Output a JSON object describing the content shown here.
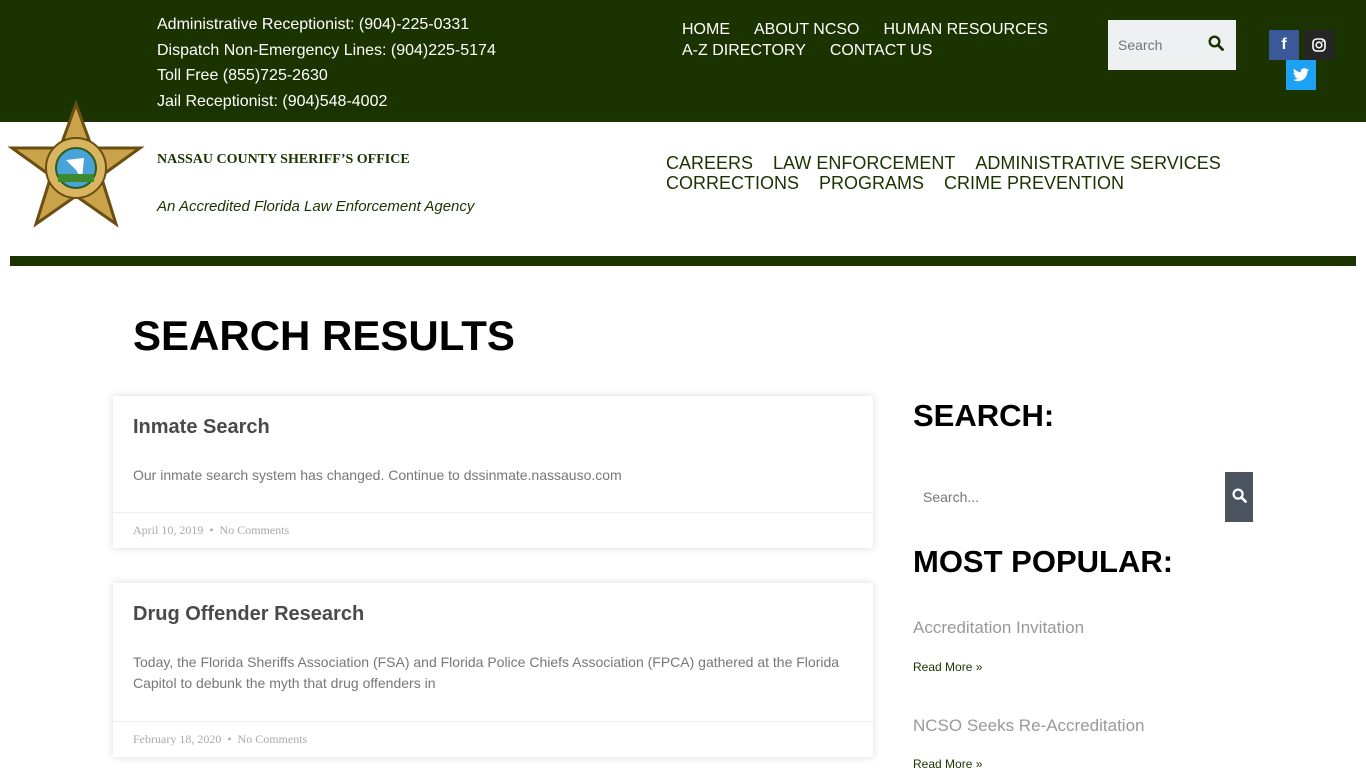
{
  "topbar": {
    "contacts": [
      "Administrative Receptionist: (904)-225-0331",
      "Dispatch Non-Emergency Lines: (904)225-5174",
      "Toll Free (855)725-2630",
      "Jail Receptionist: (904)548-4002"
    ],
    "nav": [
      "HOME",
      "ABOUT NCSO",
      "HUMAN RESOURCES",
      "A-Z DIRECTORY",
      "CONTACT US"
    ],
    "search_placeholder": "Search",
    "social": [
      {
        "icon": "facebook-icon",
        "color": "#3b5998"
      },
      {
        "icon": "instagram-icon",
        "color": "#262626"
      },
      {
        "icon": "twitter-icon",
        "color": "#1da1f2"
      }
    ]
  },
  "header": {
    "org_name": "NASSAU COUNTY SHERIFF’S OFFICE",
    "tagline": "An Accredited Florida Law Enforcement Agency",
    "logo_text": "SHERIFF'S OFFICE NASSAU COUNTY",
    "nav": [
      "CAREERS",
      "LAW ENFORCEMENT",
      "ADMINISTRATIVE SERVICES",
      "CORRECTIONS",
      "PROGRAMS",
      "CRIME PREVENTION"
    ]
  },
  "colors": {
    "brand": "#1b3300"
  },
  "page_title": "SEARCH RESULTS",
  "results": [
    {
      "title": "Inmate Search",
      "excerpt": "Our inmate search system has changed. Continue to dssinmate.nassauso.com",
      "date": "April 10, 2019",
      "sep": "•",
      "comments": "No Comments"
    },
    {
      "title": "Drug Offender Research",
      "excerpt": "Today, the Florida Sheriffs Association (FSA) and Florida Police Chiefs Association (FPCA) gathered at the Florida Capitol to debunk the myth that drug offenders in",
      "date": "February 18, 2020",
      "sep": "•",
      "comments": "No Comments"
    }
  ],
  "sidebar": {
    "search_heading": "SEARCH:",
    "search_placeholder": "Search...",
    "popular_heading": "MOST POPULAR:",
    "popular": [
      {
        "title": "Accreditation Invitation",
        "link": "Read More »"
      },
      {
        "title": "NCSO Seeks Re-Accreditation",
        "link": "Read More »"
      }
    ]
  }
}
